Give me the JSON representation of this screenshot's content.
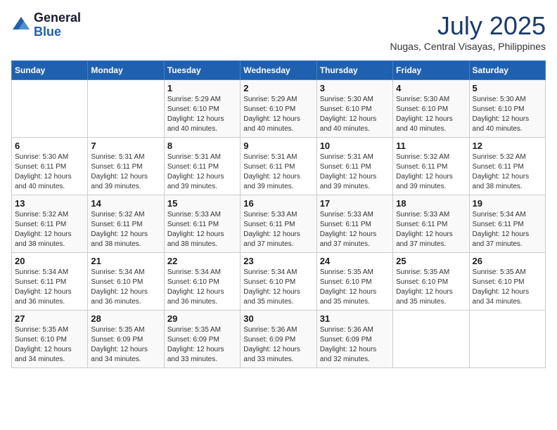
{
  "header": {
    "logo": {
      "line1": "General",
      "line2": "Blue"
    },
    "title": "July 2025",
    "location": "Nugas, Central Visayas, Philippines"
  },
  "weekdays": [
    "Sunday",
    "Monday",
    "Tuesday",
    "Wednesday",
    "Thursday",
    "Friday",
    "Saturday"
  ],
  "weeks": [
    [
      {
        "day": "",
        "info": ""
      },
      {
        "day": "",
        "info": ""
      },
      {
        "day": "1",
        "info": "Sunrise: 5:29 AM\nSunset: 6:10 PM\nDaylight: 12 hours and 40 minutes."
      },
      {
        "day": "2",
        "info": "Sunrise: 5:29 AM\nSunset: 6:10 PM\nDaylight: 12 hours and 40 minutes."
      },
      {
        "day": "3",
        "info": "Sunrise: 5:30 AM\nSunset: 6:10 PM\nDaylight: 12 hours and 40 minutes."
      },
      {
        "day": "4",
        "info": "Sunrise: 5:30 AM\nSunset: 6:10 PM\nDaylight: 12 hours and 40 minutes."
      },
      {
        "day": "5",
        "info": "Sunrise: 5:30 AM\nSunset: 6:10 PM\nDaylight: 12 hours and 40 minutes."
      }
    ],
    [
      {
        "day": "6",
        "info": "Sunrise: 5:30 AM\nSunset: 6:11 PM\nDaylight: 12 hours and 40 minutes."
      },
      {
        "day": "7",
        "info": "Sunrise: 5:31 AM\nSunset: 6:11 PM\nDaylight: 12 hours and 39 minutes."
      },
      {
        "day": "8",
        "info": "Sunrise: 5:31 AM\nSunset: 6:11 PM\nDaylight: 12 hours and 39 minutes."
      },
      {
        "day": "9",
        "info": "Sunrise: 5:31 AM\nSunset: 6:11 PM\nDaylight: 12 hours and 39 minutes."
      },
      {
        "day": "10",
        "info": "Sunrise: 5:31 AM\nSunset: 6:11 PM\nDaylight: 12 hours and 39 minutes."
      },
      {
        "day": "11",
        "info": "Sunrise: 5:32 AM\nSunset: 6:11 PM\nDaylight: 12 hours and 39 minutes."
      },
      {
        "day": "12",
        "info": "Sunrise: 5:32 AM\nSunset: 6:11 PM\nDaylight: 12 hours and 38 minutes."
      }
    ],
    [
      {
        "day": "13",
        "info": "Sunrise: 5:32 AM\nSunset: 6:11 PM\nDaylight: 12 hours and 38 minutes."
      },
      {
        "day": "14",
        "info": "Sunrise: 5:32 AM\nSunset: 6:11 PM\nDaylight: 12 hours and 38 minutes."
      },
      {
        "day": "15",
        "info": "Sunrise: 5:33 AM\nSunset: 6:11 PM\nDaylight: 12 hours and 38 minutes."
      },
      {
        "day": "16",
        "info": "Sunrise: 5:33 AM\nSunset: 6:11 PM\nDaylight: 12 hours and 37 minutes."
      },
      {
        "day": "17",
        "info": "Sunrise: 5:33 AM\nSunset: 6:11 PM\nDaylight: 12 hours and 37 minutes."
      },
      {
        "day": "18",
        "info": "Sunrise: 5:33 AM\nSunset: 6:11 PM\nDaylight: 12 hours and 37 minutes."
      },
      {
        "day": "19",
        "info": "Sunrise: 5:34 AM\nSunset: 6:11 PM\nDaylight: 12 hours and 37 minutes."
      }
    ],
    [
      {
        "day": "20",
        "info": "Sunrise: 5:34 AM\nSunset: 6:11 PM\nDaylight: 12 hours and 36 minutes."
      },
      {
        "day": "21",
        "info": "Sunrise: 5:34 AM\nSunset: 6:10 PM\nDaylight: 12 hours and 36 minutes."
      },
      {
        "day": "22",
        "info": "Sunrise: 5:34 AM\nSunset: 6:10 PM\nDaylight: 12 hours and 36 minutes."
      },
      {
        "day": "23",
        "info": "Sunrise: 5:34 AM\nSunset: 6:10 PM\nDaylight: 12 hours and 35 minutes."
      },
      {
        "day": "24",
        "info": "Sunrise: 5:35 AM\nSunset: 6:10 PM\nDaylight: 12 hours and 35 minutes."
      },
      {
        "day": "25",
        "info": "Sunrise: 5:35 AM\nSunset: 6:10 PM\nDaylight: 12 hours and 35 minutes."
      },
      {
        "day": "26",
        "info": "Sunrise: 5:35 AM\nSunset: 6:10 PM\nDaylight: 12 hours and 34 minutes."
      }
    ],
    [
      {
        "day": "27",
        "info": "Sunrise: 5:35 AM\nSunset: 6:10 PM\nDaylight: 12 hours and 34 minutes."
      },
      {
        "day": "28",
        "info": "Sunrise: 5:35 AM\nSunset: 6:09 PM\nDaylight: 12 hours and 34 minutes."
      },
      {
        "day": "29",
        "info": "Sunrise: 5:35 AM\nSunset: 6:09 PM\nDaylight: 12 hours and 33 minutes."
      },
      {
        "day": "30",
        "info": "Sunrise: 5:36 AM\nSunset: 6:09 PM\nDaylight: 12 hours and 33 minutes."
      },
      {
        "day": "31",
        "info": "Sunrise: 5:36 AM\nSunset: 6:09 PM\nDaylight: 12 hours and 32 minutes."
      },
      {
        "day": "",
        "info": ""
      },
      {
        "day": "",
        "info": ""
      }
    ]
  ]
}
